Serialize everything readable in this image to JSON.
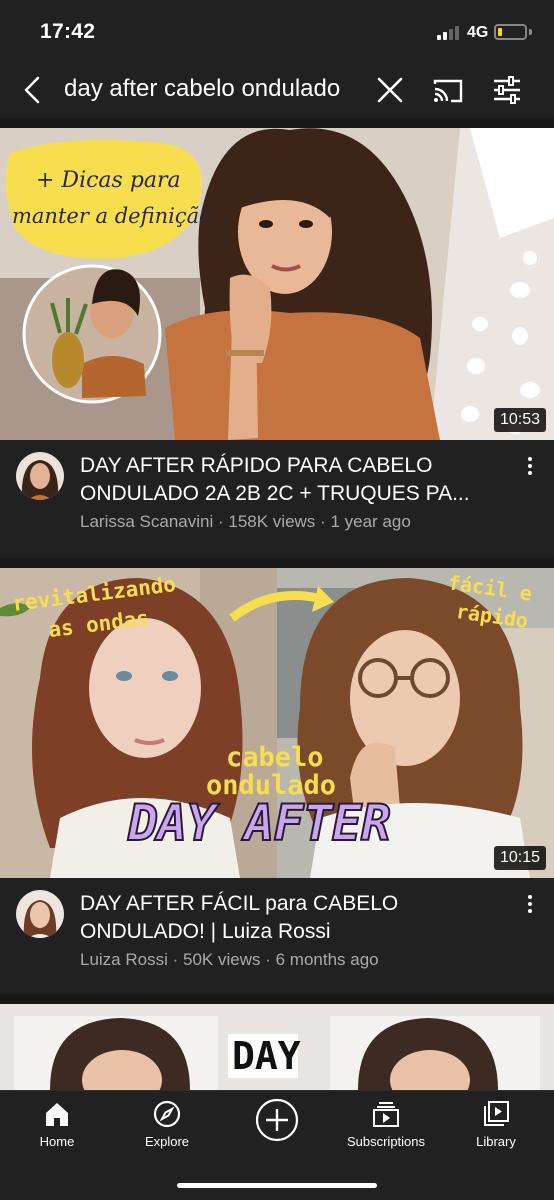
{
  "status_bar": {
    "time": "17:42",
    "network": "4G"
  },
  "search": {
    "query": "day after cabelo ondulado"
  },
  "videos": [
    {
      "title": "DAY AFTER RÁPIDO PARA CABELO ONDULADO 2A 2B 2C + TRUQUES PA...",
      "channel": "Larissa Scanavini",
      "views": "158K views",
      "age": "1 year ago",
      "duration": "10:53",
      "thumb_text_1": "+ Dicas para",
      "thumb_text_2": "manter a definição"
    },
    {
      "title": "DAY AFTER FÁCIL para CABELO ONDULADO! | Luiza Rossi",
      "channel": "Luiza Rossi",
      "views": "50K views",
      "age": "6 months ago",
      "duration": "10:15",
      "thumb_text_1": "revitalizando",
      "thumb_text_2": "as ondas",
      "thumb_text_3": "fácil e",
      "thumb_text_4": "rápido",
      "thumb_text_5": "cabelo",
      "thumb_text_6": "ondulado",
      "thumb_text_7": "DAY AFTER"
    },
    {
      "thumb_text_1": "DAY"
    }
  ],
  "nav": [
    {
      "label": "Home",
      "icon": "home-icon"
    },
    {
      "label": "Explore",
      "icon": "compass-icon"
    },
    {
      "label": "",
      "icon": "create-plus-icon"
    },
    {
      "label": "Subscriptions",
      "icon": "subscriptions-icon"
    },
    {
      "label": "Library",
      "icon": "library-icon"
    }
  ],
  "colors": {
    "background": "#212121",
    "secondary_text": "#aaaaaa",
    "accent_yellow": "#f7de4e",
    "accent_purple": "#c9a6ee"
  }
}
